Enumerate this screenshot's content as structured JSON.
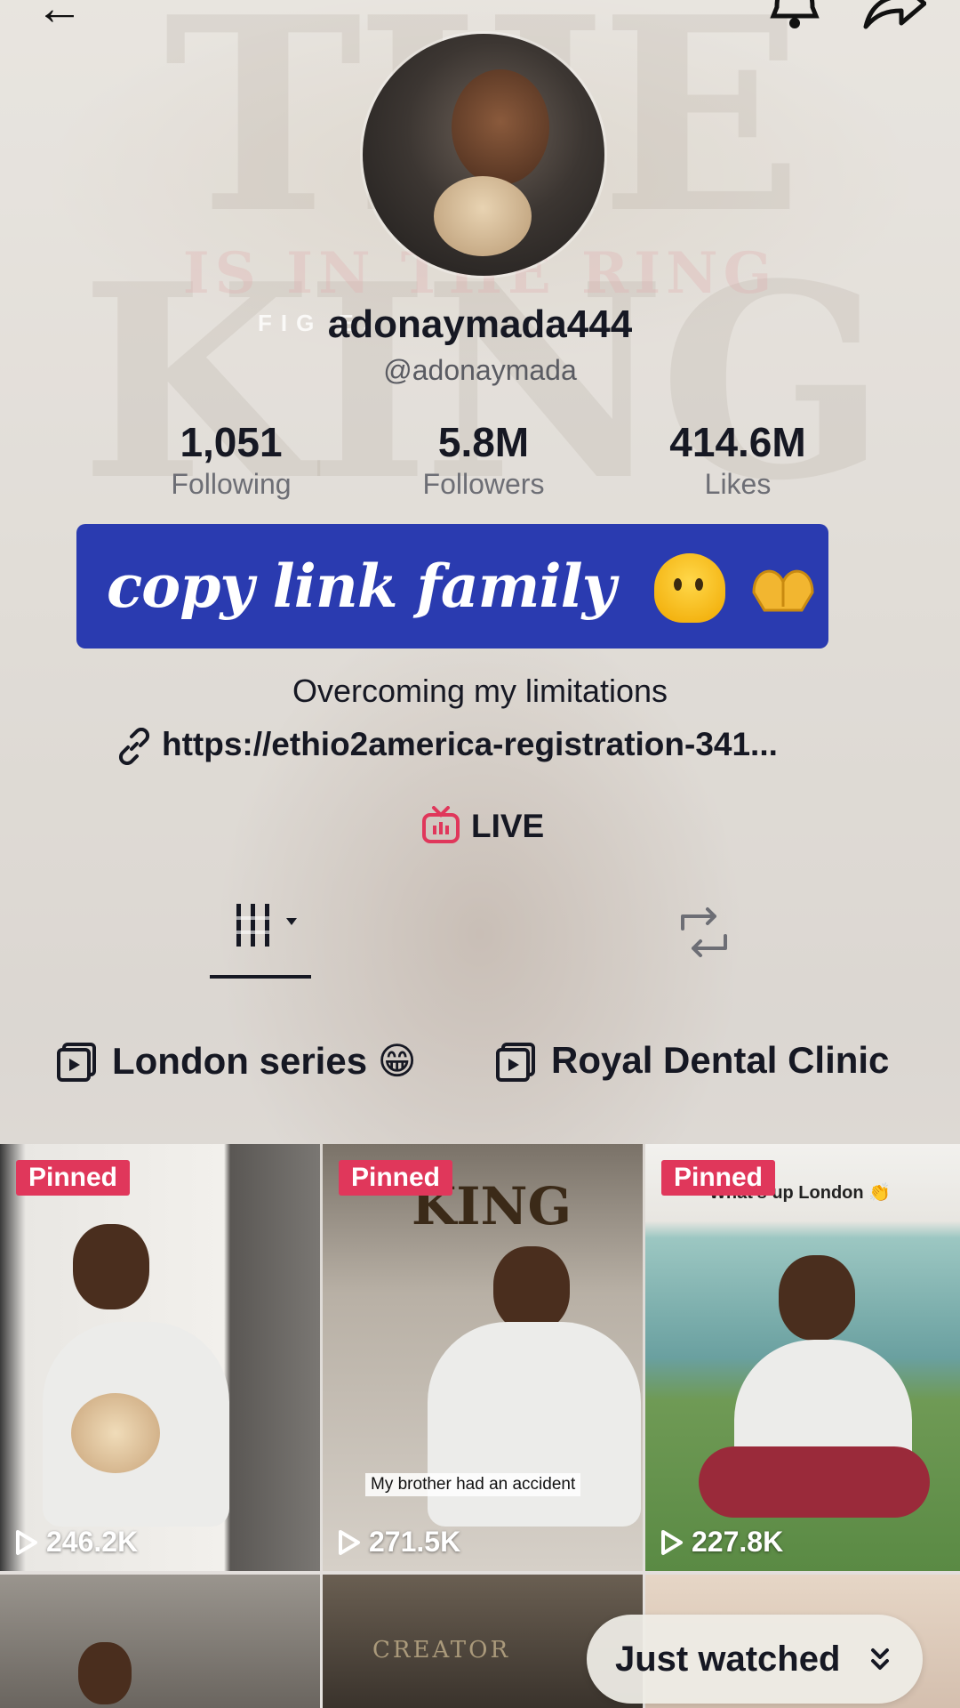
{
  "background": {
    "poster_title": "THE KING",
    "poster_subtitle": "IS IN THE RING",
    "poster_tag": "FIG E."
  },
  "profile": {
    "username": "adonaymada444",
    "handle": "@adonaymada",
    "stats": [
      {
        "value": "1,051",
        "label": "Following"
      },
      {
        "value": "5.8M",
        "label": "Followers"
      },
      {
        "value": "414.6M",
        "label": "Likes"
      }
    ],
    "banner_text": "copy link family",
    "bio": "Overcoming my limitations",
    "link": "https://ethio2america-registration-341...",
    "live_label": "LIVE"
  },
  "playlists": [
    {
      "label": "London series 😁"
    },
    {
      "label": "Royal Dental Clinic"
    }
  ],
  "videos": [
    {
      "pinned": "Pinned",
      "views": "246.2K",
      "caption": ""
    },
    {
      "pinned": "Pinned",
      "views": "271.5K",
      "caption": "My brother had an accident",
      "overlay": "KING"
    },
    {
      "pinned": "Pinned",
      "views": "227.8K",
      "caption": "What's up London 👏"
    }
  ],
  "second_row_caption": "CREATOR",
  "just_watched": "Just watched",
  "colors": {
    "banner": "#2a3bb0",
    "pinned": "#e0375b",
    "text": "#161823"
  },
  "icons": [
    "back-icon",
    "bell-icon",
    "share-icon",
    "link-icon",
    "live-tv-icon",
    "grid-icon",
    "repost-icon",
    "playlist-icon",
    "play-icon",
    "chevron-down-icon"
  ]
}
